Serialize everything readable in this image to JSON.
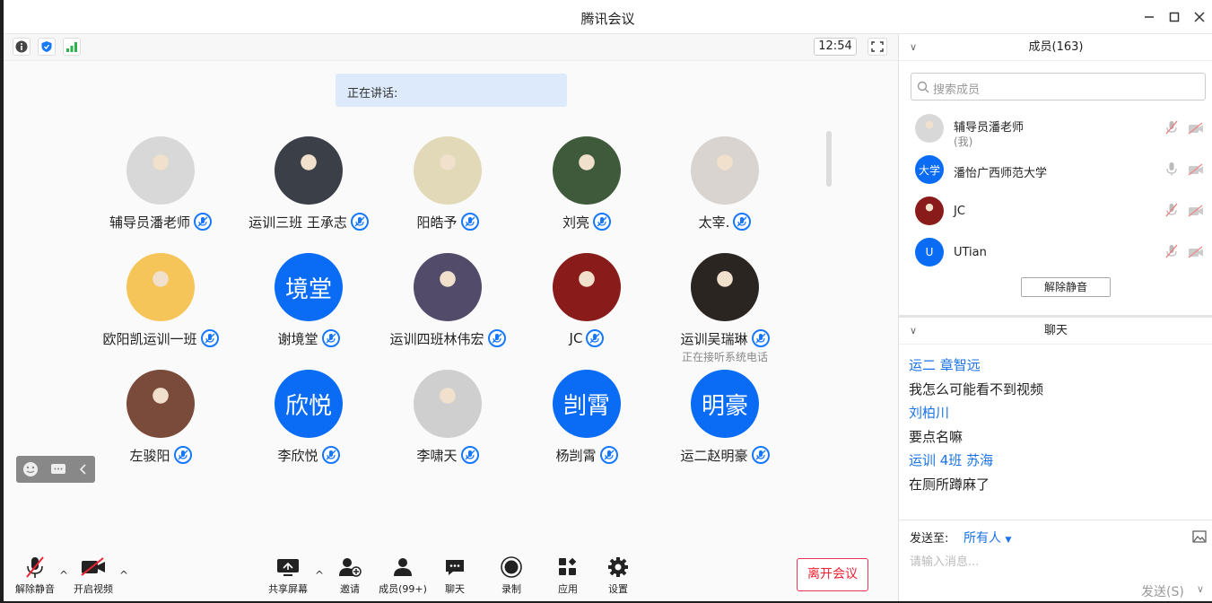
{
  "window": {
    "title": "腾讯会议"
  },
  "topbar": {
    "clock": "12:54"
  },
  "speaking_label": "正在讲话:",
  "participants": [
    {
      "name": "辅导员潘老师",
      "avatar": "photo",
      "color": "#d8d8d8"
    },
    {
      "name": "运训三班 王承志",
      "avatar": "photo",
      "color": "#3a3f48"
    },
    {
      "name": "阳皓予",
      "avatar": "photo",
      "color": "#e2d9b8"
    },
    {
      "name": "刘亮",
      "avatar": "photo",
      "color": "#3e5a3a"
    },
    {
      "name": "太宰.",
      "avatar": "photo",
      "color": "#d9d4cf"
    },
    {
      "name": "欧阳凯运训一班",
      "avatar": "photo",
      "color": "#f5c55a"
    },
    {
      "name": "谢境堂",
      "avatar_text": "境堂"
    },
    {
      "name": "运训四班林伟宏",
      "avatar": "photo",
      "color": "#524b6a"
    },
    {
      "name": "JC",
      "avatar": "photo",
      "color": "#8a1b1b"
    },
    {
      "name": "运训吴瑞琳",
      "avatar": "photo",
      "color": "#2b2522",
      "sub": "正在接听系统电话"
    },
    {
      "name": "左骏阳",
      "avatar": "photo",
      "color": "#7a4a3a"
    },
    {
      "name": "李欣悦",
      "avatar_text": "欣悦"
    },
    {
      "name": "李啸天",
      "avatar": "photo",
      "color": "#cfcfcf"
    },
    {
      "name": "杨剀霄",
      "avatar_text": "剀霄"
    },
    {
      "name": "运二赵明豪",
      "avatar_text": "明豪"
    }
  ],
  "toolbar": {
    "mute": "解除静音",
    "video": "开启视频",
    "share": "共享屏幕",
    "invite": "邀请",
    "members": "成员(99+)",
    "chat": "聊天",
    "record": "录制",
    "apps": "应用",
    "settings": "设置",
    "leave": "离开会议"
  },
  "members_panel": {
    "title": "成员(163)",
    "search_placeholder": "搜索成员",
    "unmute_all": "解除静音",
    "members": [
      {
        "name": "辅导员潘老师",
        "sub": "(我)",
        "avatar": "photo",
        "color": "#d8d8d8"
      },
      {
        "name": "潘怡广西师范大学",
        "avatar_text": "大学"
      },
      {
        "name": "JC",
        "avatar": "photo",
        "color": "#8a1b1b"
      },
      {
        "name": "UTian",
        "avatar_text": "U"
      }
    ]
  },
  "chat_panel": {
    "title": "聊天",
    "messages": [
      {
        "user": "运二 章智远",
        "text": "我怎么可能看不到视频"
      },
      {
        "user": "刘柏川",
        "text": "要点名嘛"
      },
      {
        "user": "运训 4班 苏海",
        "text": "在厕所蹲麻了"
      }
    ],
    "send_to_label": "发送至:",
    "send_target": "所有人",
    "input_placeholder": "请输入消息...",
    "send_button": "发送(S)"
  },
  "colors": {
    "accent": "#0a6cf5",
    "link": "#1a73e8",
    "danger": "#e23333"
  }
}
